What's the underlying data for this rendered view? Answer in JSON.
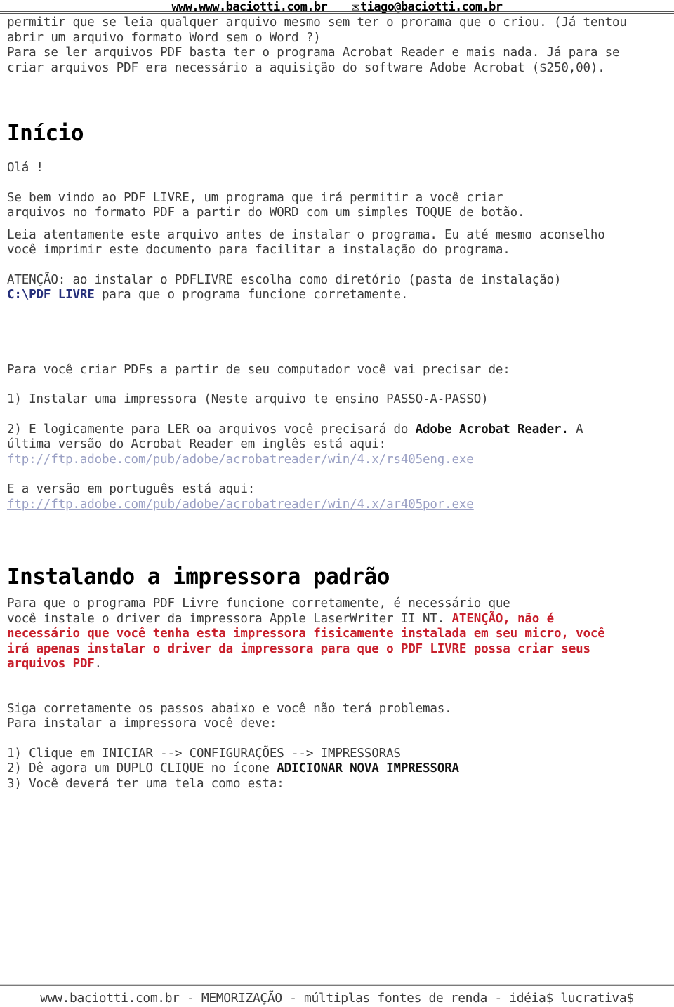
{
  "header": {
    "site": "www.www.baciotti.com.br",
    "email": "tiago@baciotti.com.br",
    "email_icon": "envelope-icon",
    "envelope_glyph": "✉"
  },
  "footer": {
    "text": "www.baciotti.com.br - MEMORIZAÇÃO - múltiplas fontes de renda - idéia$ lucrativa$"
  },
  "body": {
    "intro": {
      "line1": "permitir que se leia qualquer arquivo mesmo sem ter o prorama que o criou. (Já tentou",
      "line2": "abrir um arquivo formato Word sem o Word ?)",
      "line3": "Para se ler arquivos PDF basta ter o programa Acrobat Reader e mais nada. Já para se",
      "line4": "criar arquivos PDF era necessário a aquisição do software Adobe Acrobat ($250,00)."
    },
    "heading_inicio": "Início",
    "greeting": "Olá !",
    "welcome": {
      "line1": "Se bem vindo ao PDF LIVRE, um programa que irá permitir a você criar",
      "line2": "arquivos no formato PDF a partir do WORD com um simples TOQUE de botão."
    },
    "read_carefully": {
      "line1": "Leia atentamente este arquivo antes de instalar o programa. Eu até mesmo aconselho",
      "line2": "você imprimir este documento para facilitar a instalação do programa."
    },
    "attention_dir": {
      "line1": "ATENÇÃO: ao instalar o PDFLIVRE escolha como diretório (pasta de instalação)",
      "path": "C:\\PDF LIVRE",
      "line2_tail": " para que o programa funcione corretamente."
    },
    "need_intro": "Para você criar PDFs a partir de seu computador você vai precisar de:",
    "item1": "1) Instalar uma impressora (Neste arquivo te ensino PASSO-A-PASSO)",
    "item2": {
      "prefix": "2) E logicamente para LER oa arquivos você precisará do ",
      "bold": "Adobe Acrobat Reader.",
      "suffix": " A",
      "line2": "última versão do Acrobat Reader em inglês está aqui:",
      "link_en": "ftp://ftp.adobe.com/pub/adobe/acrobatreader/win/4.x/rs405eng.exe"
    },
    "pt_version": {
      "line1": "E a versão em português está aqui:",
      "link_pt": "ftp://ftp.adobe.com/pub/adobe/acrobatreader/win/4.x/ar405por.exe"
    },
    "heading_instalando": "Instalando a impressora padrão",
    "printer_para": {
      "line1": "Para que o programa PDF Livre funcione corretamente, é necessário que",
      "line2_prefix": "você instale o driver da impressora Apple LaserWriter II NT. ",
      "red1": "ATENÇÃO, não é",
      "red2": "necessário que você tenha esta impressora fisicamente instalada em seu micro, você",
      "red3": "irá apenas instalar o driver da impressora para que o PDF LIVRE possa criar seus",
      "red4": "arquivos PDF",
      "tail": "."
    },
    "steps_intro": {
      "line1": "Siga corretamente os passos abaixo e você não terá problemas.",
      "line2": "Para instalar a impressora você deve:"
    },
    "steps": {
      "s1": "1) Clique em INICIAR --> CONFIGURAÇÕES --> IMPRESSORAS",
      "s2_prefix": "2) Dê agora um DUPLO CLIQUE no ícone ",
      "s2_bold": "ADICIONAR NOVA IMPRESSORA",
      "s3": "3) Você deverá ter uma tela como esta:"
    }
  },
  "colors": {
    "text": "#3c3c3c",
    "heading": "#000000",
    "path_blue": "#26307a",
    "warning_red": "#c8202c",
    "link": "#9aa0c4",
    "rule": "#7a7a7a"
  }
}
